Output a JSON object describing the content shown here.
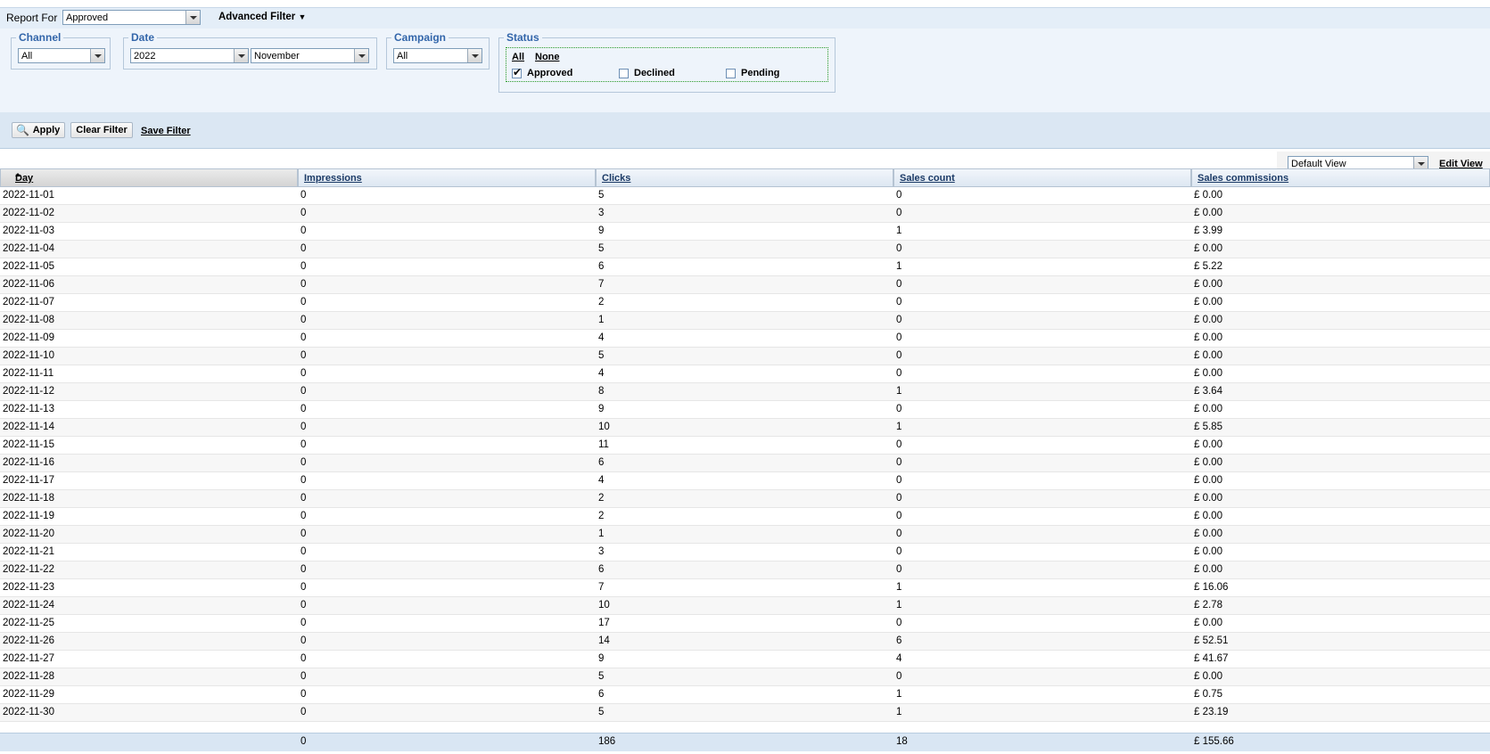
{
  "filter": {
    "report_for_label": "Report For",
    "report_for_value": "Approved",
    "advanced_filter_label": "Advanced Filter",
    "channel": {
      "legend": "Channel",
      "value": "All"
    },
    "date": {
      "legend": "Date",
      "year": "2022",
      "month": "November"
    },
    "campaign": {
      "legend": "Campaign",
      "value": "All"
    },
    "status": {
      "legend": "Status",
      "all_link": "All",
      "none_link": "None",
      "options": [
        {
          "label": "Approved",
          "checked": true
        },
        {
          "label": "Declined",
          "checked": false
        },
        {
          "label": "Pending",
          "checked": false
        }
      ]
    },
    "apply_label": "Apply",
    "clear_label": "Clear Filter",
    "save_label": "Save Filter"
  },
  "view": {
    "selected": "Default View",
    "edit_label": "Edit View"
  },
  "table": {
    "columns": [
      "Day",
      "Impressions",
      "Clicks",
      "Sales count",
      "Sales commissions"
    ],
    "rows": [
      [
        "2022-11-01",
        "0",
        "5",
        "0",
        "£ 0.00"
      ],
      [
        "2022-11-02",
        "0",
        "3",
        "0",
        "£ 0.00"
      ],
      [
        "2022-11-03",
        "0",
        "9",
        "1",
        "£ 3.99"
      ],
      [
        "2022-11-04",
        "0",
        "5",
        "0",
        "£ 0.00"
      ],
      [
        "2022-11-05",
        "0",
        "6",
        "1",
        "£ 5.22"
      ],
      [
        "2022-11-06",
        "0",
        "7",
        "0",
        "£ 0.00"
      ],
      [
        "2022-11-07",
        "0",
        "2",
        "0",
        "£ 0.00"
      ],
      [
        "2022-11-08",
        "0",
        "1",
        "0",
        "£ 0.00"
      ],
      [
        "2022-11-09",
        "0",
        "4",
        "0",
        "£ 0.00"
      ],
      [
        "2022-11-10",
        "0",
        "5",
        "0",
        "£ 0.00"
      ],
      [
        "2022-11-11",
        "0",
        "4",
        "0",
        "£ 0.00"
      ],
      [
        "2022-11-12",
        "0",
        "8",
        "1",
        "£ 3.64"
      ],
      [
        "2022-11-13",
        "0",
        "9",
        "0",
        "£ 0.00"
      ],
      [
        "2022-11-14",
        "0",
        "10",
        "1",
        "£ 5.85"
      ],
      [
        "2022-11-15",
        "0",
        "11",
        "0",
        "£ 0.00"
      ],
      [
        "2022-11-16",
        "0",
        "6",
        "0",
        "£ 0.00"
      ],
      [
        "2022-11-17",
        "0",
        "4",
        "0",
        "£ 0.00"
      ],
      [
        "2022-11-18",
        "0",
        "2",
        "0",
        "£ 0.00"
      ],
      [
        "2022-11-19",
        "0",
        "2",
        "0",
        "£ 0.00"
      ],
      [
        "2022-11-20",
        "0",
        "1",
        "0",
        "£ 0.00"
      ],
      [
        "2022-11-21",
        "0",
        "3",
        "0",
        "£ 0.00"
      ],
      [
        "2022-11-22",
        "0",
        "6",
        "0",
        "£ 0.00"
      ],
      [
        "2022-11-23",
        "0",
        "7",
        "1",
        "£ 16.06"
      ],
      [
        "2022-11-24",
        "0",
        "10",
        "1",
        "£ 2.78"
      ],
      [
        "2022-11-25",
        "0",
        "17",
        "0",
        "£ 0.00"
      ],
      [
        "2022-11-26",
        "0",
        "14",
        "6",
        "£ 52.51"
      ],
      [
        "2022-11-27",
        "0",
        "9",
        "4",
        "£ 41.67"
      ],
      [
        "2022-11-28",
        "0",
        "5",
        "0",
        "£ 0.00"
      ],
      [
        "2022-11-29",
        "0",
        "6",
        "1",
        "£ 0.75"
      ],
      [
        "2022-11-30",
        "0",
        "5",
        "1",
        "£ 23.19"
      ]
    ],
    "totals": [
      "",
      "0",
      "186",
      "18",
      "£ 155.66"
    ]
  }
}
